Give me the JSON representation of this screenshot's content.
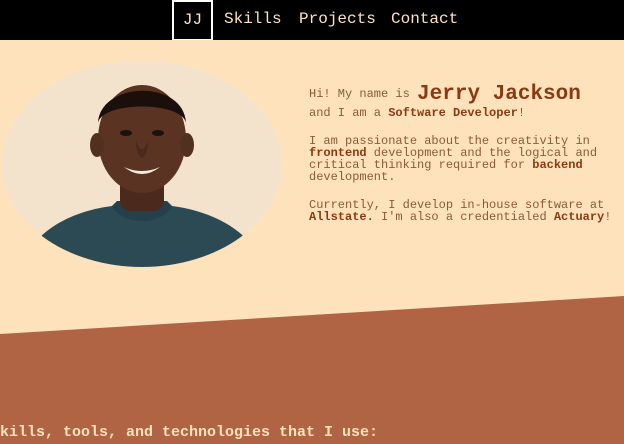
{
  "nav": {
    "logo": "JJ",
    "links": [
      "Skills",
      "Projects",
      "Contact"
    ]
  },
  "intro": {
    "greeting_prefix": "Hi! My name is ",
    "name": "Jerry Jackson",
    "role_prefix": "and I am a ",
    "role": "Software Developer",
    "role_suffix": "!",
    "p2_a": "I am passionate about the creativity in ",
    "p2_frontend": "frontend",
    "p2_b": " development and the logical and critical thinking required for ",
    "p2_backend": "backend",
    "p2_c": " development.",
    "p3_a": "Currently, I develop in-house software at ",
    "p3_company": "Allstate.",
    "p3_b": " I'm also a credentialed ",
    "p3_actuary": "Actuary",
    "p3_c": "!"
  },
  "skills": {
    "heading": "kills, tools, and technologies that I use:"
  },
  "colors": {
    "nav_bg": "#000000",
    "page_bg": "#fde2bc",
    "accent_dark": "#8a3a12",
    "band": "#b16444"
  }
}
